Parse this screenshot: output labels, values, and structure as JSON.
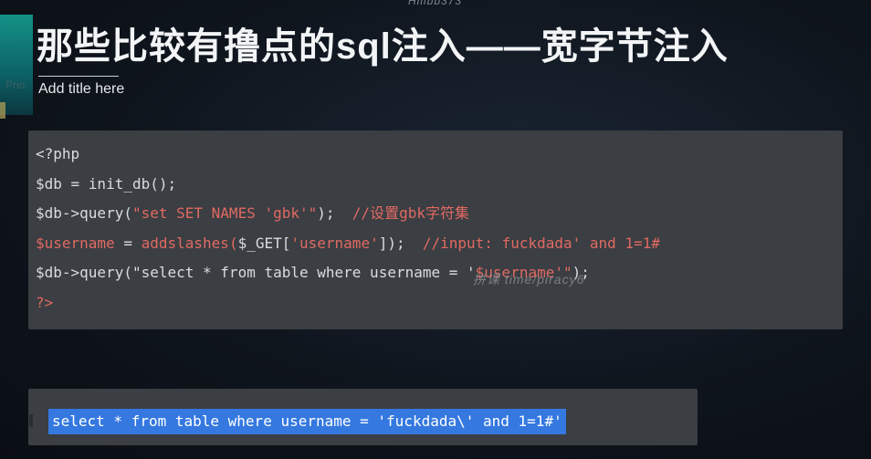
{
  "watermark_top": "Hmbb373",
  "title": "那些比较有撸点的sql注入——宽字节注入",
  "subtitle": "Add title here",
  "ghost_left": "Prio",
  "code": {
    "lines": [
      {
        "parts": [
          {
            "t": "<?php",
            "c": "var"
          }
        ]
      },
      {
        "parts": [
          {
            "t": "$db = init_db();",
            "c": "var"
          }
        ]
      },
      {
        "parts": [
          {
            "t": "$db->query(",
            "c": "var"
          },
          {
            "t": "\"set SET NAMES 'gbk'\"",
            "c": "str"
          },
          {
            "t": ");  ",
            "c": "var"
          },
          {
            "t": "//设置gbk字符集",
            "c": "cmt"
          }
        ]
      },
      {
        "parts": [
          {
            "t": "$username",
            "c": "str"
          },
          {
            "t": " = ",
            "c": "var"
          },
          {
            "t": "addslashes(",
            "c": "str"
          },
          {
            "t": "$_GET[",
            "c": "var"
          },
          {
            "t": "'username'",
            "c": "str"
          },
          {
            "t": "]);  ",
            "c": "var"
          },
          {
            "t": "//input: fuckdada' and 1=1#",
            "c": "cmt"
          }
        ]
      },
      {
        "parts": [
          {
            "t": "$db->query(",
            "c": "var"
          },
          {
            "t": "\"select * from table where username = '",
            "c": "var"
          },
          {
            "t": "$username",
            "c": "str"
          },
          {
            "t": "'\"",
            "c": "str"
          },
          {
            "t": ");",
            "c": "var"
          }
        ]
      },
      {
        "parts": [
          {
            "t": "?>",
            "c": "str"
          }
        ]
      }
    ]
  },
  "watermark_mid": "拼课  time/piracy6",
  "result": "select * from table where username = 'fuckdada\\' and 1=1#'"
}
